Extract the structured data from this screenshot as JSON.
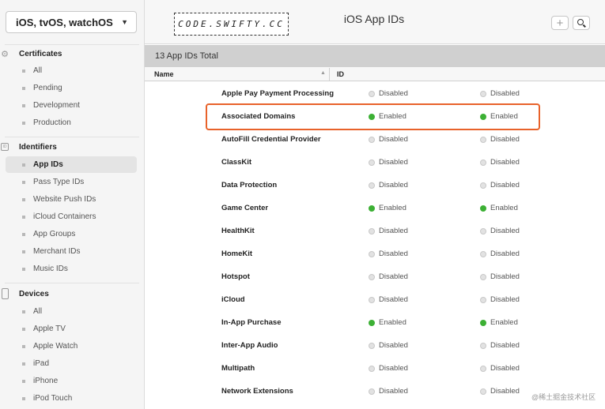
{
  "sidebar": {
    "platform_label": "iOS, tvOS, watchOS",
    "certificates": {
      "title": "Certificates",
      "items": [
        "All",
        "Pending",
        "Development",
        "Production"
      ]
    },
    "identifiers": {
      "title": "Identifiers",
      "items": [
        "App IDs",
        "Pass Type IDs",
        "Website Push IDs",
        "iCloud Containers",
        "App Groups",
        "Merchant IDs",
        "Music IDs"
      ],
      "active": "App IDs"
    },
    "devices": {
      "title": "Devices",
      "items": [
        "All",
        "Apple TV",
        "Apple Watch",
        "iPad",
        "iPhone",
        "iPod Touch"
      ]
    }
  },
  "header": {
    "logo_text": "CODE.SWIFTY.CC",
    "title": "iOS App IDs",
    "add_label": "+"
  },
  "summary": {
    "count_label": "13 App IDs Total"
  },
  "table": {
    "columns": {
      "name": "Name",
      "id": "ID"
    },
    "rows": [
      {
        "capability": "Apple Pay Payment Processing",
        "col1": "Disabled",
        "col2": "Disabled"
      },
      {
        "capability": "Associated Domains",
        "col1": "Enabled",
        "col2": "Enabled",
        "highlighted": true
      },
      {
        "capability": "AutoFill Credential Provider",
        "col1": "Disabled",
        "col2": "Disabled"
      },
      {
        "capability": "ClassKit",
        "col1": "Disabled",
        "col2": "Disabled"
      },
      {
        "capability": "Data Protection",
        "col1": "Disabled",
        "col2": "Disabled"
      },
      {
        "capability": "Game Center",
        "col1": "Enabled",
        "col2": "Enabled"
      },
      {
        "capability": "HealthKit",
        "col1": "Disabled",
        "col2": "Disabled"
      },
      {
        "capability": "HomeKit",
        "col1": "Disabled",
        "col2": "Disabled"
      },
      {
        "capability": "Hotspot",
        "col1": "Disabled",
        "col2": "Disabled"
      },
      {
        "capability": "iCloud",
        "col1": "Disabled",
        "col2": "Disabled"
      },
      {
        "capability": "In-App Purchase",
        "col1": "Enabled",
        "col2": "Enabled"
      },
      {
        "capability": "Inter-App Audio",
        "col1": "Disabled",
        "col2": "Disabled"
      },
      {
        "capability": "Multipath",
        "col1": "Disabled",
        "col2": "Disabled"
      },
      {
        "capability": "Network Extensions",
        "col1": "Disabled",
        "col2": "Disabled"
      }
    ]
  },
  "colors": {
    "enabled": "#3cb034",
    "disabled": "#e2e2e2",
    "highlight": "#e8622a"
  },
  "icons": [
    "gear-icon",
    "id-card-icon",
    "device-icon",
    "plus-icon",
    "search-icon",
    "chevron-down-icon",
    "sort-up-icon"
  ],
  "watermark": "@稀土掘金技术社区"
}
